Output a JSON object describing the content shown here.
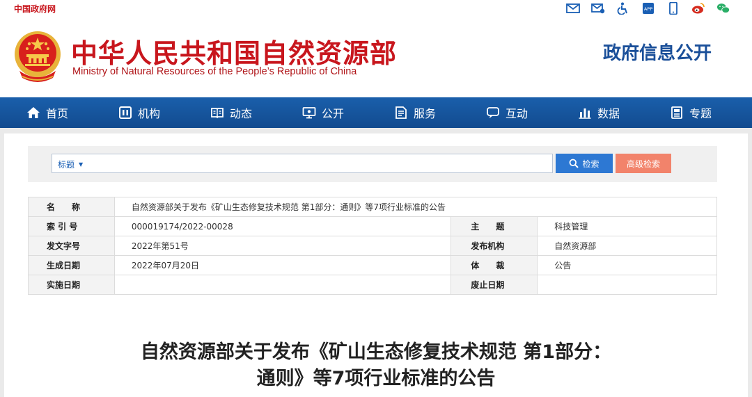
{
  "topbar": {
    "gov_link": "中国政府网",
    "icons": [
      "mail-icon",
      "mail-settings-icon",
      "accessibility-icon",
      "app-icon",
      "mobile-icon",
      "weibo-icon",
      "wechat-icon"
    ]
  },
  "header": {
    "title_cn": "中华人民共和国自然资源部",
    "title_en": "Ministry of Natural Resources of the People’s Republic of China",
    "section": "政府信息公开"
  },
  "nav": {
    "items": [
      {
        "label": "首页",
        "icon": "home-icon"
      },
      {
        "label": "机构",
        "icon": "org-icon"
      },
      {
        "label": "动态",
        "icon": "news-icon"
      },
      {
        "label": "公开",
        "icon": "monitor-icon"
      },
      {
        "label": "服务",
        "icon": "document-icon"
      },
      {
        "label": "互动",
        "icon": "chat-icon"
      },
      {
        "label": "数据",
        "icon": "bar-chart-icon"
      },
      {
        "label": "专题",
        "icon": "topic-icon"
      }
    ]
  },
  "search": {
    "type_label": "标题",
    "value": "",
    "search_button": "检索",
    "advanced_button": "高级检索"
  },
  "meta": {
    "name_label": "名　　称",
    "name_value": "自然资源部关于发布《矿山生态修复技术规范 第1部分：通则》等7项行业标准的公告",
    "index_label": "索 引 号",
    "index_value": "000019174/2022-00028",
    "subject_label": "主　　题",
    "subject_value": "科技管理",
    "docno_label": "发文字号",
    "docno_value": "2022年第51号",
    "issuer_label": "发布机构",
    "issuer_value": "自然资源部",
    "date_label": "生成日期",
    "date_value": "2022年07月20日",
    "genre_label": "体　　裁",
    "genre_value": "公告",
    "effective_label": "实施日期",
    "effective_value": "",
    "expire_label": "废止日期",
    "expire_value": ""
  },
  "document": {
    "title_line1": "自然资源部关于发布《矿山生态修复技术规范 第1部分：",
    "title_line2": "通则》等7项行业标准的公告"
  },
  "colors": {
    "brand_red": "#c8161d",
    "nav_blue": "#1a5fab",
    "accent_blue": "#2d78d3",
    "advanced_orange": "#f2836b"
  }
}
